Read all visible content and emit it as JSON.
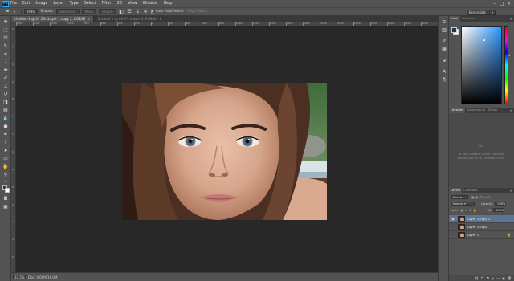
{
  "app": {
    "logo": "Ps",
    "menu": [
      "File",
      "Edit",
      "Image",
      "Layer",
      "Type",
      "Select",
      "Filter",
      "3D",
      "View",
      "Window",
      "Help"
    ],
    "window_controls": [
      "–",
      "□",
      "×"
    ]
  },
  "options_bar": {
    "tool_icon": "brush-icon",
    "buttons": [
      "Path",
      "Shapes",
      "Selection:",
      "Mask",
      "Shape"
    ],
    "auto_add_delete_label": "Auto Add/Delete",
    "align_edges_label": "Align Edges",
    "workspace": "Essentials"
  },
  "doc_tabs": [
    {
      "label": "Untitled-1 @ 37.5% (Layer 1 copy 2, RGB/8)",
      "active": true
    },
    {
      "label": "Untitled-1 @ 66.7% (Layer 0, RGB/8)",
      "active": false
    }
  ],
  "rulers": {
    "h_labels": [
      "1600",
      "1400",
      "1200",
      "1000",
      "800",
      "600",
      "400",
      "200",
      "0",
      "200",
      "400",
      "600",
      "800",
      "1000",
      "1200",
      "1400",
      "1600",
      "1800",
      "2000",
      "2200",
      "2400",
      "2600",
      "2800",
      "3000",
      "3200"
    ],
    "v_labels": [
      "0",
      "2",
      "4",
      "6",
      "8",
      "1",
      "2",
      "4",
      "6",
      "8",
      "2",
      "2",
      "4",
      "6"
    ]
  },
  "status": {
    "zoom": "37.5%",
    "doc": "Doc: 4.00M/16.0M"
  },
  "colors": {
    "foreground": "#1b3a52",
    "background": "#ffffff",
    "accent_selection": "#5c7391",
    "picker_hue": "#2d95ff"
  },
  "color_panel": {
    "tabs": [
      "Color",
      "Swatches"
    ]
  },
  "libraries_panel": {
    "tabs": [
      "Libraries",
      "Adjustments",
      "Styles"
    ],
    "message_line1": "To use Creative Cloud Libraries,",
    "message_line2": "please sign in to Creative Cloud."
  },
  "layers_panel": {
    "tabs": [
      "Layers",
      "Channels"
    ],
    "kind_filter": "Kind",
    "blend_mode": "Normal",
    "opacity_label": "Opacity:",
    "opacity_value": "100%",
    "lock_label": "Lock:",
    "fill_label": "Fill:",
    "fill_value": "100%",
    "layers": [
      {
        "name": "Layer 1 copy 2",
        "selected": true,
        "locked": false
      },
      {
        "name": "Layer 1 copy",
        "selected": false,
        "locked": false
      },
      {
        "name": "Layer 1",
        "selected": false,
        "locked": true
      }
    ]
  }
}
